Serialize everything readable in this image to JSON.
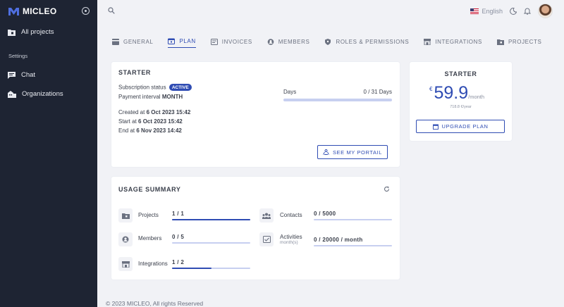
{
  "sidebar": {
    "brand": "MICLEO",
    "items": [
      {
        "label": "All projects",
        "icon": "folder-icon"
      },
      {
        "label": "Chat",
        "icon": "chat-icon"
      },
      {
        "label": "Organizations",
        "icon": "building-icon"
      }
    ],
    "section_label": "Settings"
  },
  "topbar": {
    "language": "English"
  },
  "tabs": [
    {
      "label": "GENERAL",
      "icon": "card-icon"
    },
    {
      "label": "PLAN",
      "icon": "calendar-icon",
      "active": true
    },
    {
      "label": "INVOICES",
      "icon": "invoice-icon"
    },
    {
      "label": "MEMBERS",
      "icon": "user-icon"
    },
    {
      "label": "ROLES & PERMISSIONS",
      "icon": "shield-icon"
    },
    {
      "label": "INTEGRATIONS",
      "icon": "store-icon"
    },
    {
      "label": "PROJECTS",
      "icon": "folder-icon"
    }
  ],
  "plan": {
    "title": "STARTER",
    "status_label": "Subscription status",
    "status_value": "ACTIVE",
    "interval_label": "Payment interval",
    "interval_value": "MONTH",
    "created_label": "Created at",
    "created_value": "6 Oct 2023 15:42",
    "start_label": "Start at",
    "start_value": "6 Oct 2023 15:42",
    "end_label": "End at",
    "end_value": "6 Nov 2023 14:42",
    "days_label": "Days",
    "days_value": "0 / 31 Days",
    "days_progress": 0,
    "portal_button": "SEE MY PORTAIL"
  },
  "price_card": {
    "title": "STARTER",
    "currency": "€",
    "amount": "59.9",
    "period": "/month",
    "yearly": "718.8 €/year",
    "upgrade_button": "UPGRADE PLAN"
  },
  "usage": {
    "title": "USAGE SUMMARY",
    "items": [
      {
        "name": "Projects",
        "sub": "",
        "value": "1 / 1",
        "progress": 1.0,
        "icon": "folder-icon"
      },
      {
        "name": "Contacts",
        "sub": "",
        "value": "0 / 5000",
        "progress": 0,
        "icon": "contacts-icon"
      },
      {
        "name": "Members",
        "sub": "",
        "value": "0 / 5",
        "progress": 0,
        "icon": "user-icon"
      },
      {
        "name": "Activities",
        "sub": "month(s)",
        "value": "0 / 20000 / month",
        "progress": 0,
        "icon": "activity-icon"
      },
      {
        "name": "Integrations",
        "sub": "",
        "value": "1 / 2",
        "progress": 0.5,
        "icon": "store-icon"
      }
    ]
  },
  "footer": {
    "text": "© 2023 MICLEO, All rights Reserved"
  },
  "colors": {
    "accent": "#2f4cb3",
    "sidebar_bg": "#1e2433",
    "page_bg": "#f1f2f6"
  }
}
